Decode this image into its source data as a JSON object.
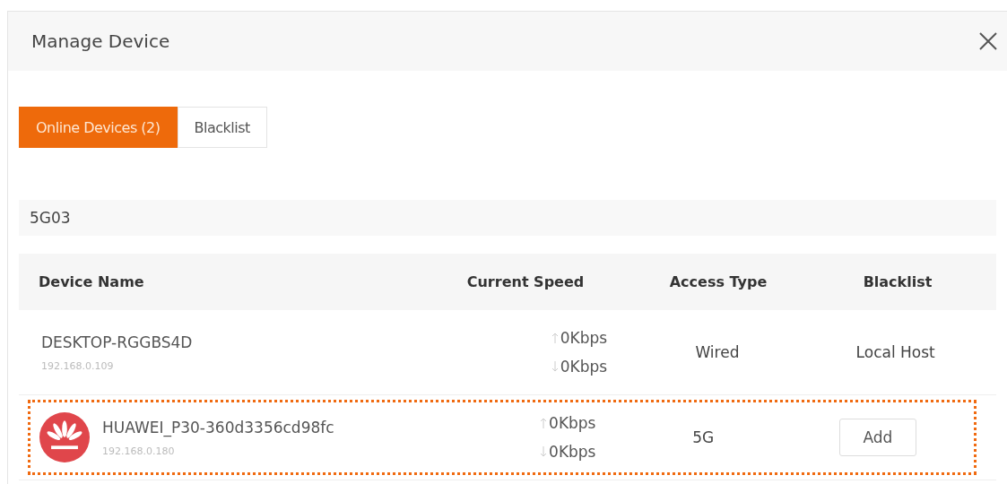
{
  "dialog": {
    "title": "Manage Device"
  },
  "tabs": [
    {
      "label": "Online Devices (2)",
      "selected": true
    },
    {
      "label": "Blacklist",
      "selected": false
    }
  ],
  "group": {
    "name": "5G03"
  },
  "table": {
    "columns": [
      "Device Name",
      "Current Speed",
      "Access Type",
      "Blacklist"
    ],
    "rows": [
      {
        "name": "DESKTOP-RGGBS4D",
        "ip": "192.168.0.109",
        "up": "0Kbps",
        "down": "0Kbps",
        "access": "Wired",
        "blacklist": {
          "kind": "text",
          "label": "Local Host"
        },
        "avatar": false,
        "highlighted": false
      },
      {
        "name": "HUAWEI_P30-360d3356cd98fc",
        "ip": "192.168.0.180",
        "up": "0Kbps",
        "down": "0Kbps",
        "access": "5G",
        "blacklist": {
          "kind": "button",
          "label": "Add"
        },
        "avatar": true,
        "highlighted": true
      }
    ]
  }
}
